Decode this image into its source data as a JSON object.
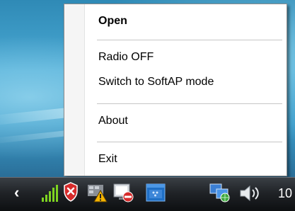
{
  "context_menu": {
    "items": [
      {
        "label": "Open",
        "default": true
      },
      {
        "label": "Radio OFF"
      },
      {
        "label": "Switch to SoftAP mode"
      },
      {
        "label": "About"
      },
      {
        "label": "Exit"
      }
    ]
  },
  "taskbar": {
    "clock_partial": "10",
    "tray_icons": [
      "show-hidden-icons-chevron",
      "wifi-signal-icon",
      "security-alert-shield-icon",
      "network-tools-icon",
      "no-network-monitor-icon",
      "app-window-icon",
      "network-connection-icon",
      "volume-icon"
    ]
  },
  "colors": {
    "menu_background": "#ffffff",
    "menu_border": "#8c8c8c",
    "separator": "#c6c6c6",
    "taskbar_dark": "#1a1d20",
    "desktop_blue": "#3b9bc9"
  }
}
